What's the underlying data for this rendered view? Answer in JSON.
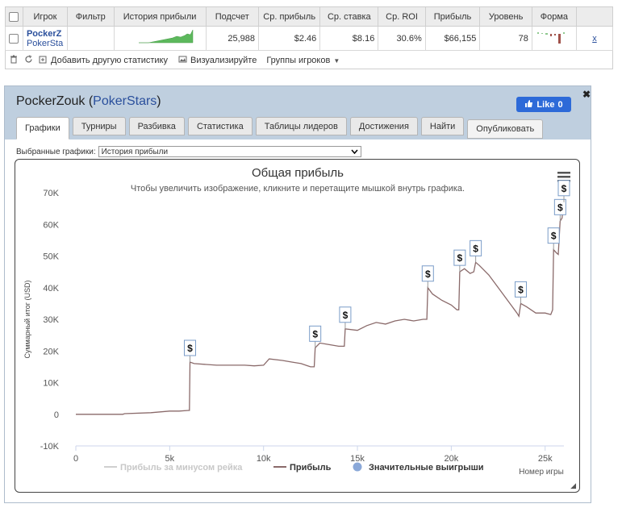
{
  "stats_table": {
    "headers": [
      "Игрок",
      "Фильтр",
      "История прибыли",
      "Подсчет",
      "Ср. прибыль",
      "Ср. ставка",
      "Ср. ROI",
      "Прибыль",
      "Уровень",
      "Форма"
    ],
    "row": {
      "player_name": "PockerZ",
      "player_site": "PokerSta",
      "filter": "",
      "count": "25,988",
      "avg_profit": "$2.46",
      "avg_stake": "$8.16",
      "avg_roi": "30.6%",
      "profit": "$66,155",
      "level": "78",
      "remove": "x"
    },
    "colors": {
      "sparkline": "#5cb85c",
      "form_positive": "#8fc98f",
      "form_negative": "#a0524a"
    }
  },
  "toolbar": {
    "add_stat": "Добавить другую статистику",
    "visualize": "Визуализируйте",
    "groups": "Группы игроков"
  },
  "panel": {
    "name": "PockerZouk",
    "site": "PokerStars",
    "paren_open": "(",
    "paren_close": ")",
    "like_label": "Like",
    "like_count": "0",
    "tabs": [
      "Графики",
      "Турниры",
      "Разбивка",
      "Статистика",
      "Таблицы лидеров",
      "Достижения",
      "Найти"
    ],
    "publish": "Опубликовать",
    "selected_label": "Выбранные графики:",
    "selected_value": "История прибыли",
    "close": "✖"
  },
  "chart_data": {
    "type": "line",
    "title": "Общая прибыль",
    "subtitle": "Чтобы увеличить изображение, кликните и перетащите мышкой внутрь графика.",
    "ylabel": "Суммарный итог (USD)",
    "xlabel": "Номер игры",
    "xlim": [
      0,
      26000
    ],
    "ylim": [
      -10000,
      70000
    ],
    "x_ticks": [
      "0",
      "5k",
      "10k",
      "15k",
      "20k",
      "25k"
    ],
    "y_ticks": [
      "-10K",
      "0",
      "10K",
      "20K",
      "30K",
      "40K",
      "50K",
      "60K",
      "70K"
    ],
    "series": [
      {
        "name": "Прибыль за минусом рейка",
        "color": "#cfcfcf",
        "visible": false
      },
      {
        "name": "Прибыль",
        "color": "#8a6a6a",
        "points": [
          [
            0,
            0
          ],
          [
            1500,
            0
          ],
          [
            2500,
            0
          ],
          [
            2600,
            200
          ],
          [
            4000,
            500
          ],
          [
            5000,
            1000
          ],
          [
            5500,
            1000
          ],
          [
            6000,
            1200
          ],
          [
            6050,
            1200
          ],
          [
            6080,
            16500
          ],
          [
            6300,
            16000
          ],
          [
            7500,
            15500
          ],
          [
            9000,
            15500
          ],
          [
            9500,
            15300
          ],
          [
            10000,
            15500
          ],
          [
            10300,
            17500
          ],
          [
            11000,
            17000
          ],
          [
            11500,
            16500
          ],
          [
            12000,
            16000
          ],
          [
            12500,
            15000
          ],
          [
            12700,
            15000
          ],
          [
            12750,
            21000
          ],
          [
            13000,
            22500
          ],
          [
            13500,
            22000
          ],
          [
            14000,
            21500
          ],
          [
            14300,
            21500
          ],
          [
            14350,
            27000
          ],
          [
            15000,
            26500
          ],
          [
            15500,
            28000
          ],
          [
            16000,
            29000
          ],
          [
            16500,
            28500
          ],
          [
            17000,
            29500
          ],
          [
            17500,
            30000
          ],
          [
            18000,
            29500
          ],
          [
            18500,
            30000
          ],
          [
            18700,
            30000
          ],
          [
            18750,
            40000
          ],
          [
            19000,
            38000
          ],
          [
            19500,
            36000
          ],
          [
            20000,
            34500
          ],
          [
            20300,
            33000
          ],
          [
            20400,
            33000
          ],
          [
            20450,
            45000
          ],
          [
            20700,
            46000
          ],
          [
            21000,
            44500
          ],
          [
            21200,
            45000
          ],
          [
            21300,
            48000
          ],
          [
            21500,
            47000
          ],
          [
            22000,
            44000
          ],
          [
            22500,
            40000
          ],
          [
            23000,
            36000
          ],
          [
            23500,
            32000
          ],
          [
            23600,
            31000
          ],
          [
            23700,
            35000
          ],
          [
            24000,
            34000
          ],
          [
            24500,
            32000
          ],
          [
            25000,
            32000
          ],
          [
            25300,
            31500
          ],
          [
            25400,
            33000
          ],
          [
            25450,
            52000
          ],
          [
            25600,
            51000
          ],
          [
            25700,
            50500
          ],
          [
            25800,
            61000
          ],
          [
            25900,
            62000
          ],
          [
            25950,
            65000
          ],
          [
            26000,
            67000
          ],
          [
            26100,
            67500
          ]
        ]
      },
      {
        "name": "Значительные выигрыши",
        "color": "#8aa8d8",
        "points": [
          [
            6080,
            16500
          ],
          [
            12750,
            21000
          ],
          [
            14350,
            27000
          ],
          [
            18750,
            40000
          ],
          [
            20450,
            45000
          ],
          [
            21300,
            48000
          ],
          [
            23700,
            35000
          ],
          [
            25450,
            52000
          ],
          [
            25800,
            61000
          ],
          [
            26000,
            67000
          ]
        ]
      }
    ],
    "legend_position": "bottom-center",
    "grid": false,
    "flag_symbol": "$"
  }
}
